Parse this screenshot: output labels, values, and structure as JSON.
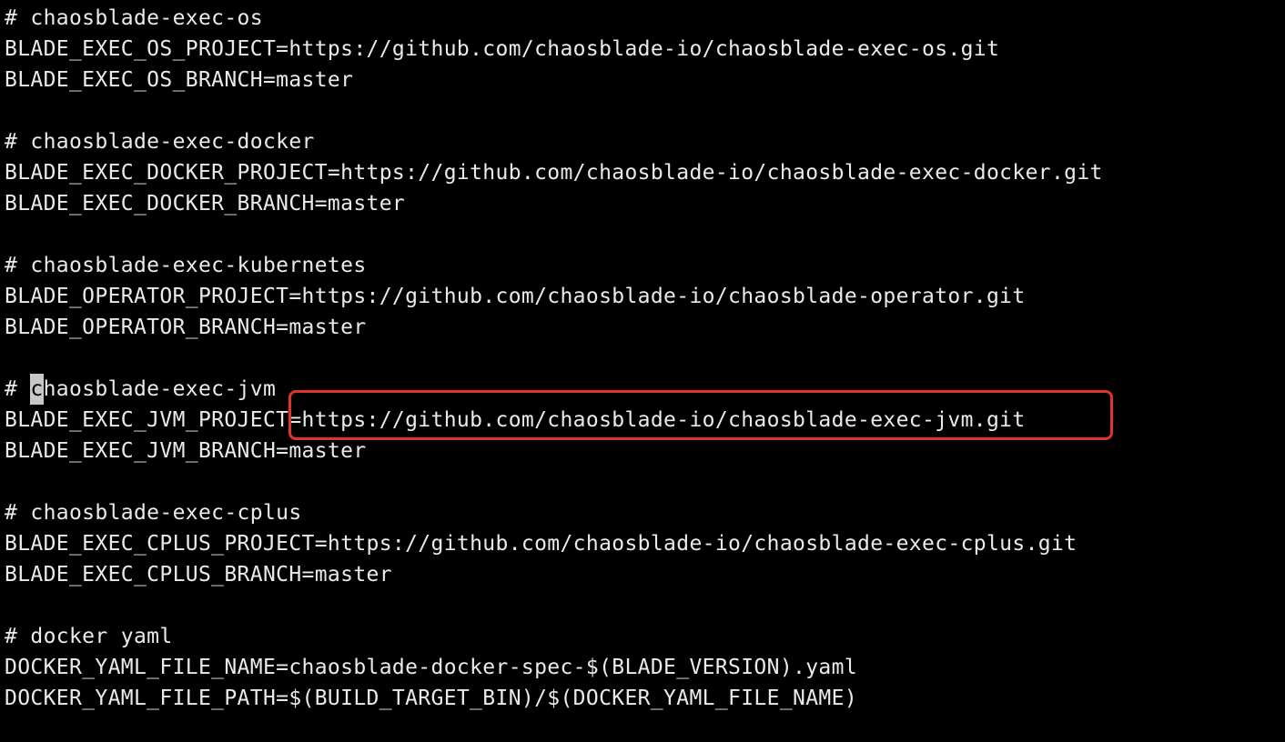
{
  "terminal": {
    "lines": {
      "l1": "# chaosblade-exec-os",
      "l2": "BLADE_EXEC_OS_PROJECT=https://github.com/chaosblade-io/chaosblade-exec-os.git",
      "l3": "BLADE_EXEC_OS_BRANCH=master",
      "l5": "# chaosblade-exec-docker",
      "l6": "BLADE_EXEC_DOCKER_PROJECT=https://github.com/chaosblade-io/chaosblade-exec-docker.git",
      "l7": "BLADE_EXEC_DOCKER_BRANCH=master",
      "l9": "# chaosblade-exec-kubernetes",
      "l10": "BLADE_OPERATOR_PROJECT=https://github.com/chaosblade-io/chaosblade-operator.git",
      "l11": "BLADE_OPERATOR_BRANCH=master",
      "l13_prefix": "# ",
      "l13_cursor": "c",
      "l13_rest": "haosblade-exec-jvm",
      "l14": "BLADE_EXEC_JVM_PROJECT=https://github.com/chaosblade-io/chaosblade-exec-jvm.git",
      "l15": "BLADE_EXEC_JVM_BRANCH=master",
      "l17": "# chaosblade-exec-cplus",
      "l18": "BLADE_EXEC_CPLUS_PROJECT=https://github.com/chaosblade-io/chaosblade-exec-cplus.git",
      "l19": "BLADE_EXEC_CPLUS_BRANCH=master",
      "l21": "# docker yaml",
      "l22": "DOCKER_YAML_FILE_NAME=chaosblade-docker-spec-$(BLADE_VERSION).yaml",
      "l23": "DOCKER_YAML_FILE_PATH=$(BUILD_TARGET_BIN)/$(DOCKER_YAML_FILE_NAME)"
    },
    "colors": {
      "background": "#000000",
      "text": "#eaeaea",
      "cursor": "#c8c8c8",
      "annotation": "#e0342b"
    }
  }
}
